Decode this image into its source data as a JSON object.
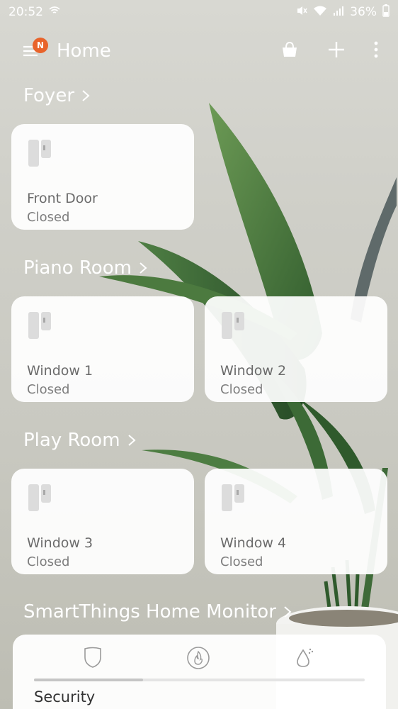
{
  "status": {
    "time": "20:52",
    "battery": "36%"
  },
  "header": {
    "title": "Home",
    "badge": "N"
  },
  "rooms": [
    {
      "name": "Foyer",
      "devices": [
        {
          "name": "Front Door",
          "state": "Closed"
        }
      ]
    },
    {
      "name": "Piano Room",
      "devices": [
        {
          "name": "Window 1",
          "state": "Closed"
        },
        {
          "name": "Window 2",
          "state": "Closed"
        }
      ]
    },
    {
      "name": "Play Room",
      "devices": [
        {
          "name": "Window 3",
          "state": "Closed"
        },
        {
          "name": "Window 4",
          "state": "Closed"
        }
      ]
    }
  ],
  "monitor": {
    "title": "SmartThings Home Monitor",
    "active_tab": "Security"
  }
}
